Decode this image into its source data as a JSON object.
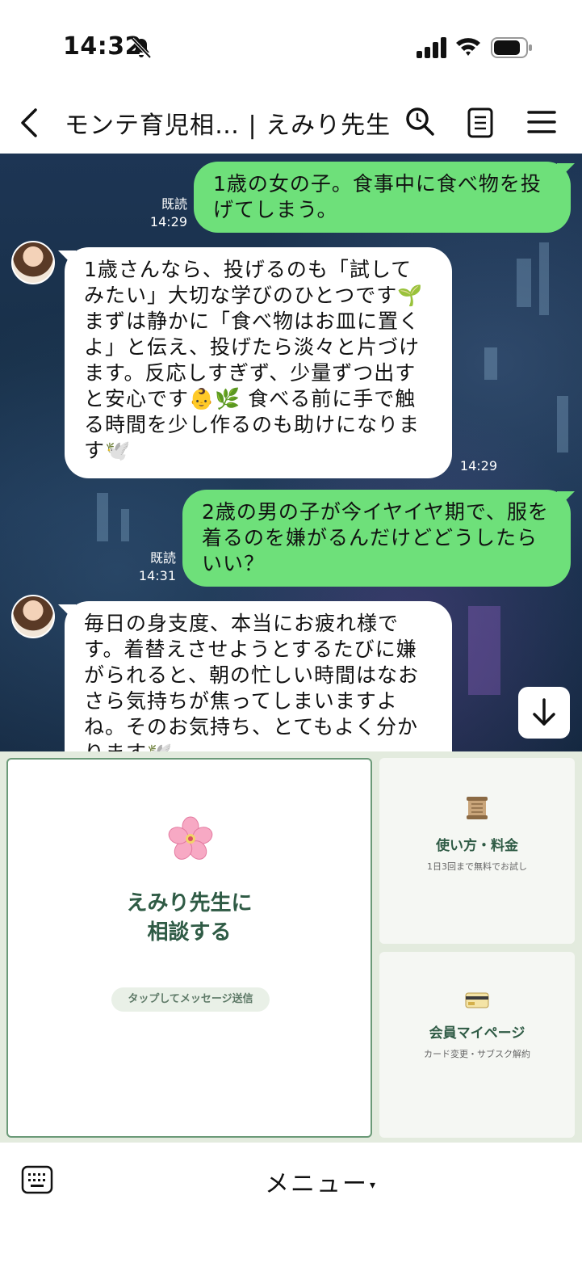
{
  "status_bar": {
    "time": "14:32",
    "icons": [
      "bell-muted-icon",
      "signal-icon",
      "wifi-icon",
      "battery-icon"
    ]
  },
  "header": {
    "title": "モンテ育児相… | えみり先生",
    "icons": [
      "back-icon",
      "search-icon",
      "notes-icon",
      "menu-icon"
    ]
  },
  "messages": [
    {
      "direction": "out",
      "text": "1歳の女の子。食事中に食べ物を投げてしまう。",
      "read": "既読",
      "time": "14:29"
    },
    {
      "direction": "in",
      "text": "1歳さんなら、投げるのも「試してみたい」大切な学びのひとつです🌱 まずは静かに「食べ物はお皿に置くよ」と伝え、投げたら淡々と片づけます。反応しすぎず、少量ずつ出すと安心です👶🌿 食べる前に手で触る時間を少し作るのも助けになります🕊️",
      "time": "14:29"
    },
    {
      "direction": "out",
      "text": "2歳の男の子が今イヤイヤ期で、服を着るのを嫌がるんだけどどうしたらいい？",
      "read": "既読",
      "time": "14:31"
    },
    {
      "direction": "in",
      "text": "毎日の身支度、本当にお疲れ様です。着替えさせようとするたびに嫌がられると、朝の忙しい時間はなおさら気持ちが焦ってしまいますよね。そのお気持ち、とてもよく分かります🕊️"
    }
  ],
  "rich_menu": {
    "main": {
      "title_line1": "えみり先生に",
      "title_line2": "相談する",
      "pill": "タップしてメッセージ送信",
      "icon": "cherry-blossom-icon"
    },
    "cards": [
      {
        "title": "使い方・料金",
        "subtitle": "1日3回まで無料でお試し",
        "icon": "scroll-icon"
      },
      {
        "title": "会員マイページ",
        "subtitle": "カード変更・サブスク解約",
        "icon": "credit-card-icon"
      }
    ]
  },
  "bottom_bar": {
    "menu_label": "メニュー",
    "caret": "▾",
    "icon": "keyboard-icon"
  }
}
